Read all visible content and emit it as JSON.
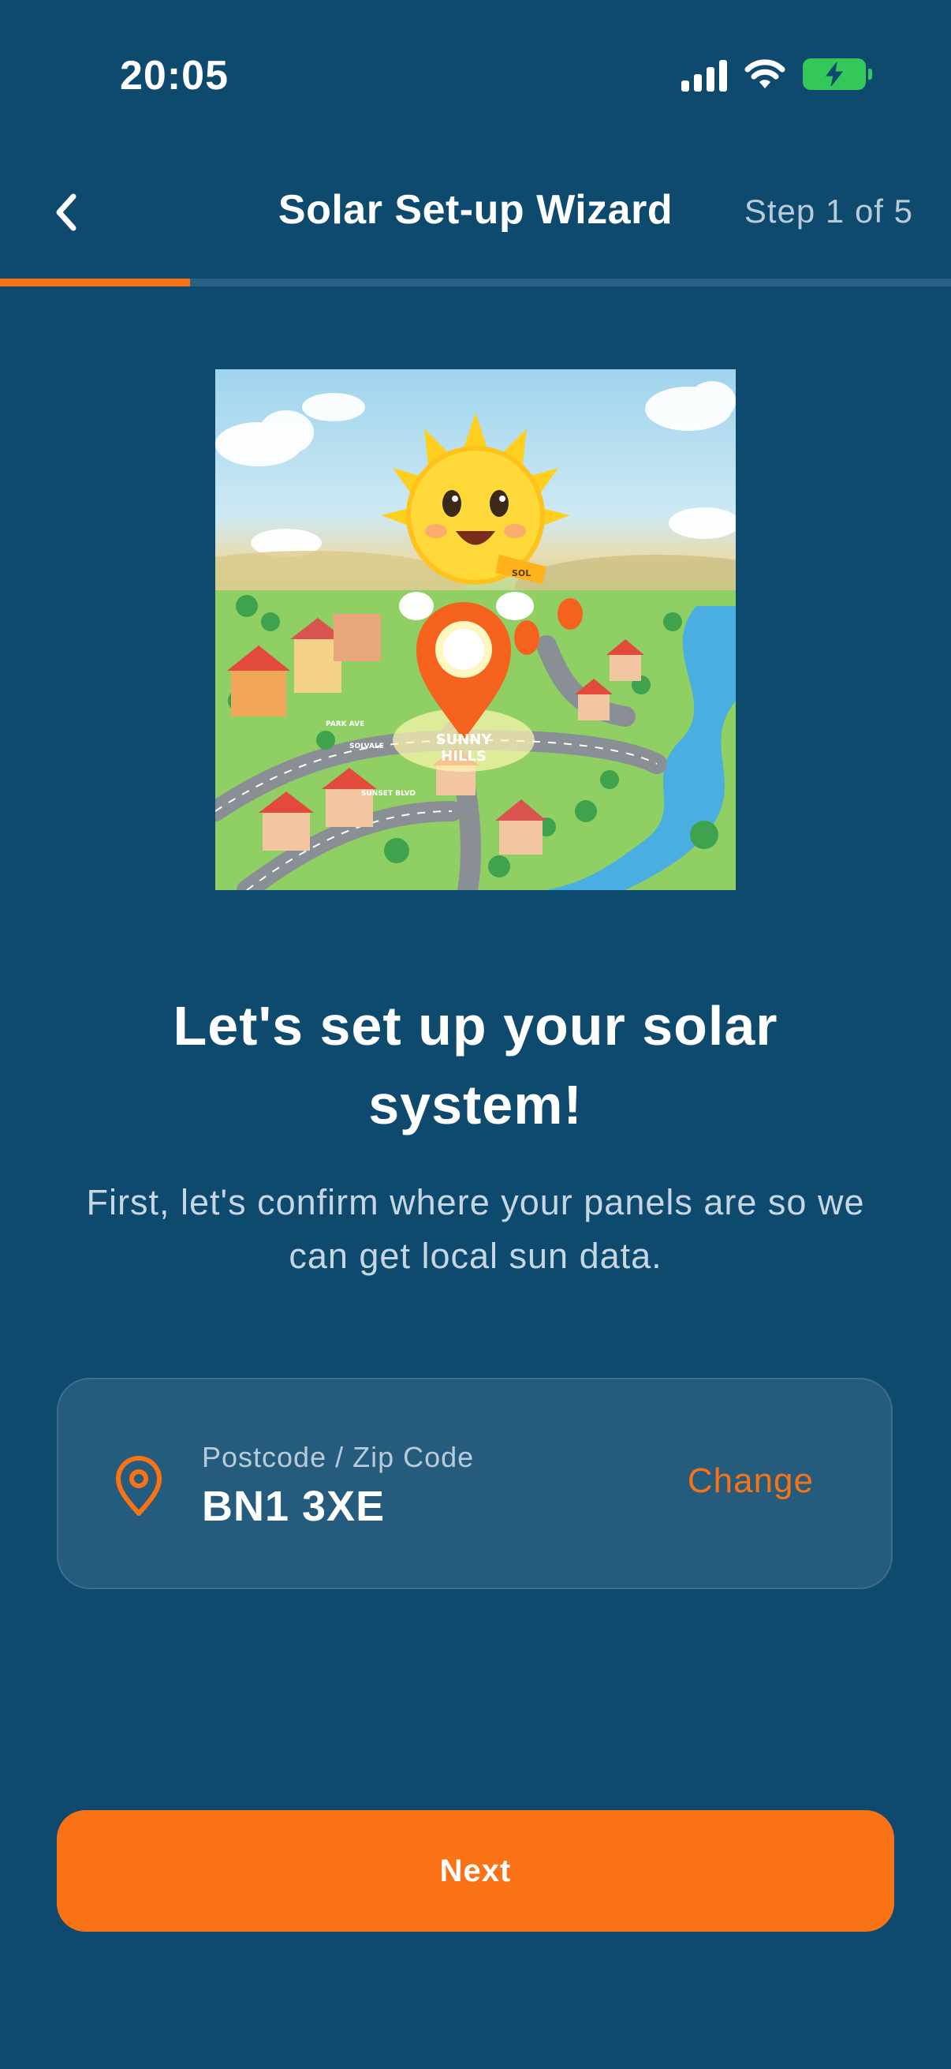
{
  "status_bar": {
    "time": "20:05",
    "icons": [
      "signal-icon",
      "wifi-icon",
      "battery-charging-icon"
    ]
  },
  "header": {
    "back_icon": "chevron-left-icon",
    "title": "Solar Set-up Wizard",
    "step_label": "Step 1 of 5"
  },
  "progress": {
    "current_step": 1,
    "total_steps": 5,
    "fraction": 0.2,
    "fill_color": "#f97316",
    "track_color": "#2a6286"
  },
  "illustration": {
    "alt": "Sun mascot holding location pin over town",
    "sun_badge": "SOL",
    "town_label_line1": "SUNNY",
    "town_label_line2": "HILLS",
    "street_1": "PARK AVE",
    "street_2": "SUNSET BLVD",
    "street_3": "SOLVALE"
  },
  "main": {
    "headline": "Let's set up your solar system!",
    "subtext": "First, let's confirm where your panels are so we can get local sun data."
  },
  "location": {
    "icon": "location-pin-icon",
    "label": "Postcode / Zip Code",
    "value": "BN1 3XE",
    "change_label": "Change"
  },
  "footer": {
    "next_label": "Next"
  },
  "colors": {
    "background": "#0e4a6e",
    "accent": "#f97316",
    "card": "#255b7d"
  }
}
